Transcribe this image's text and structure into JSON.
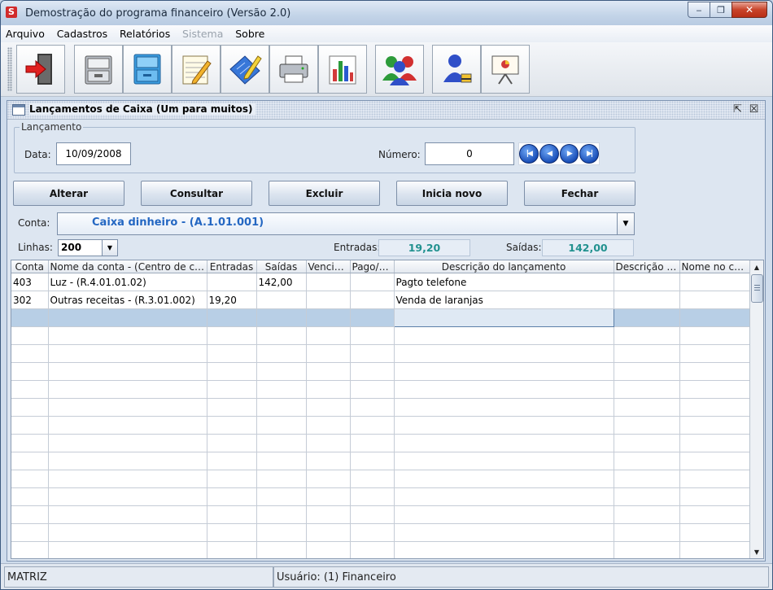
{
  "window": {
    "title": "Demostração do programa financeiro (Versão 2.0)",
    "app_icon_letter": "S",
    "minimize": "‒",
    "maximize": "❐",
    "close": "✕"
  },
  "menu": [
    "Arquivo",
    "Cadastros",
    "Relatórios",
    "Sistema",
    "Sobre"
  ],
  "toolbar_icons": [
    "exit-door-icon",
    "archive-drawer-icon",
    "filing-cabinet-icon",
    "notepad-pencil-icon",
    "blue-chart-pencil-icon",
    "printer-icon",
    "bar-chart-icon",
    "users-group-icon",
    "user-security-icon",
    "presentation-board-icon"
  ],
  "internal": {
    "title": "Lançamentos de Caixa (Um para muitos)",
    "detach": "⇱",
    "close": "☒",
    "legend": "Lançamento",
    "data_label": "Data:",
    "data_value": "10/09/2008",
    "numero_label": "Número:",
    "numero_value": "0",
    "buttons": {
      "alterar": "Alterar",
      "consultar": "Consultar",
      "excluir": "Excluir",
      "inicia_novo": "Inicia novo",
      "fechar": "Fechar"
    },
    "conta_label": "Conta:",
    "conta_value": "Caixa dinheiro - (A.1.01.001)",
    "linhas_label": "Linhas:",
    "linhas_value": "200",
    "entradas_label": "Entradas:",
    "entradas_value": "19,20",
    "saidas_label": "Saídas:",
    "saidas_value": "142,00"
  },
  "table": {
    "columns": [
      "Conta",
      "Nome da conta - (Centro de custo...",
      "Entradas",
      "Saídas",
      "Vencim...",
      "Pago/B...",
      "Descrição do lançamento",
      "Descrição d...",
      "Nome no che..."
    ],
    "rows": [
      [
        "403",
        "Luz - (R.4.01.01.02)",
        "",
        "142,00",
        "",
        "",
        "Pagto telefone",
        "",
        ""
      ],
      [
        "302",
        "Outras receitas - (R.3.01.002)",
        "19,20",
        "",
        "",
        "",
        "Venda de laranjas",
        "",
        ""
      ]
    ]
  },
  "status": {
    "left": "MATRIZ",
    "right": "Usuário: (1) Financeiro"
  }
}
